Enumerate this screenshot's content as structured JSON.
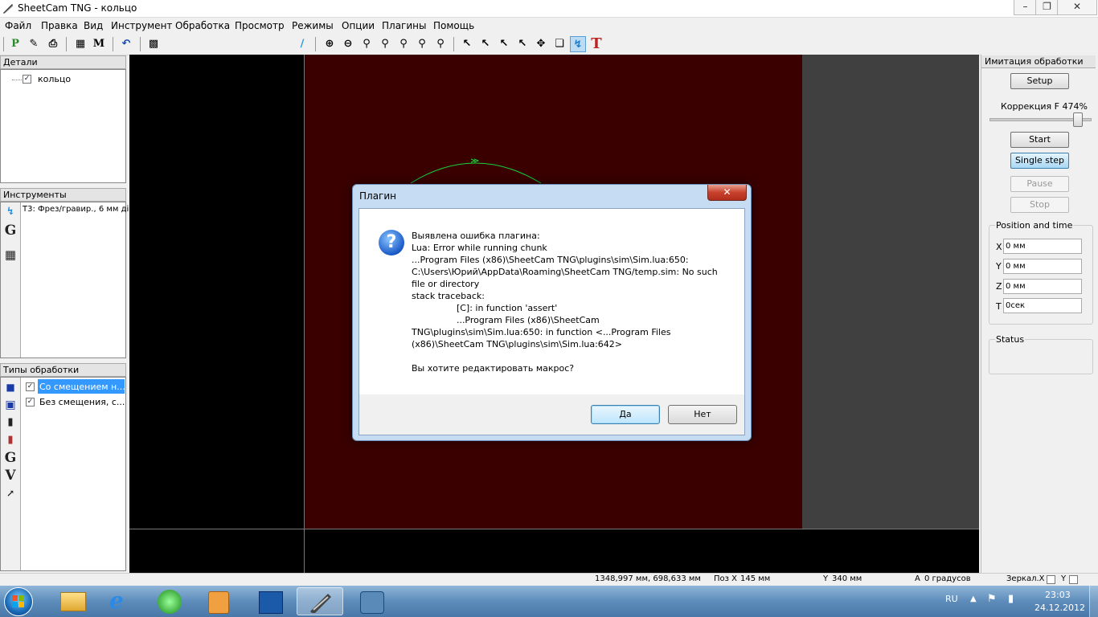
{
  "window": {
    "title": "SheetCam TNG - кольцо"
  },
  "menu": [
    "Файл",
    "Правка",
    "Вид",
    "Инструмент",
    "Обработка",
    "Просмотр",
    "Режимы",
    "Опции",
    "Плагины",
    "Помощь"
  ],
  "panels": {
    "parts": {
      "header": "Детали",
      "item": "кольцо"
    },
    "tools": {
      "header": "Инструменты",
      "item": "T3: Фрез/гравир., 6 мм ді"
    },
    "operations": {
      "header": "Типы обработки",
      "items": [
        "Со смещением н...",
        "Без смещения, с..."
      ]
    }
  },
  "sim": {
    "header": "Имитация обработки",
    "setup": "Setup",
    "feed_label": "Коррекция F 474%",
    "feed_slider_value": 0.9,
    "start": "Start",
    "single_step": "Single step",
    "pause": "Pause",
    "stop": "Stop",
    "position_header": "Position and time",
    "x_label": "X",
    "x_value": "0 мм",
    "y_label": "Y",
    "y_value": "0 мм",
    "z_label": "Z",
    "z_value": "0 мм",
    "t_label": "T",
    "t_value": "0сек",
    "status_header": "Status"
  },
  "statusbar": {
    "coords": "1348,997 мм, 698,633 мм",
    "pos_x_label": "Поз X",
    "pos_x": "145 мм",
    "pos_y_label": "Y",
    "pos_y": "340 мм",
    "angle_label": "A",
    "angle": "0 градусов",
    "mirror_label": "Зеркал.X",
    "mirror_y_label": "Y"
  },
  "dialog": {
    "title": "Плагин",
    "lines": [
      "Выявлена ошибка плагина:",
      "Lua: Error while running chunk",
      "...Program Files (x86)\\SheetCam TNG\\plugins\\sim\\Sim.lua:650:",
      "C:\\Users\\Юрий\\AppData\\Roaming\\SheetCam TNG/temp.sim: No such",
      "file or directory",
      "stack traceback:",
      "                [C]: in function 'assert'",
      "                ...Program Files (x86)\\SheetCam",
      "TNG\\plugins\\sim\\Sim.lua:650: in function <...Program Files",
      "(x86)\\SheetCam TNG\\plugins\\sim\\Sim.lua:642>"
    ],
    "question": "Вы хотите редактировать макрос?",
    "yes": "Да",
    "no": "Нет"
  },
  "tray": {
    "lang": "RU",
    "time": "23:03",
    "date": "24.12.2012"
  },
  "colors": {
    "canvas_bg": "#000000",
    "work_area": "#3a0000",
    "toolpath": "#19d23c"
  }
}
